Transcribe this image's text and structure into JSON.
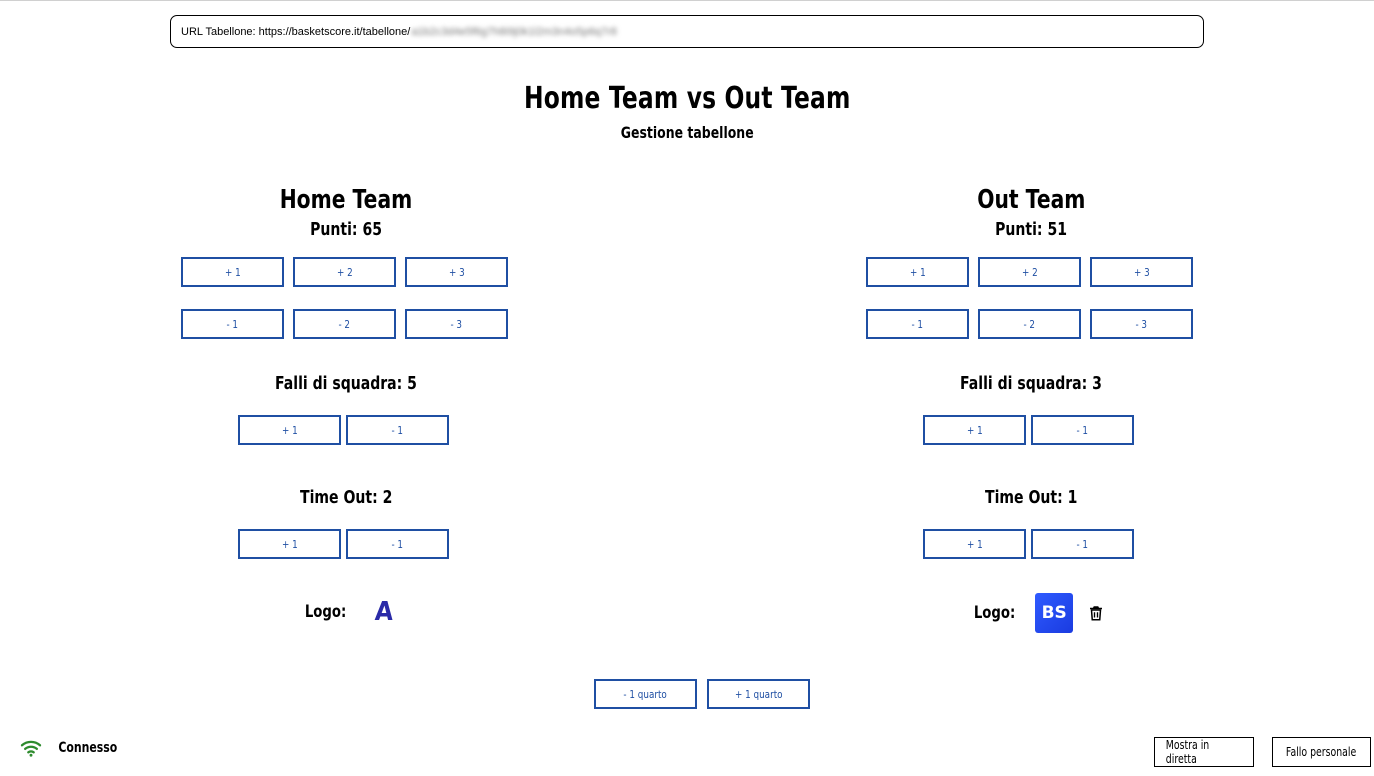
{
  "url_bar": {
    "prefix": "URL Tabellone: https://basketscore.it/tabellone/",
    "hidden": "a1b2c3d4e5f6g7h8i9j0k1l2m3n4o5p6q7r8"
  },
  "header": {
    "title": "Home Team vs Out Team",
    "subtitle": "Gestione tabellone"
  },
  "teams": {
    "home": {
      "name": "Home Team",
      "points_label": "Punti: 65",
      "add_buttons": [
        "+ 1",
        "+ 2",
        "+ 3"
      ],
      "sub_buttons": [
        "- 1",
        "- 2",
        "- 3"
      ],
      "fouls_label": "Falli di squadra: 5",
      "fouls_buttons": [
        "+ 1",
        "- 1"
      ],
      "timeout_label": "Time Out: 2",
      "timeout_buttons": [
        "+ 1",
        "- 1"
      ],
      "logo_label": "Logo:",
      "logo_text": "A"
    },
    "out": {
      "name": "Out Team",
      "points_label": "Punti: 51",
      "add_buttons": [
        "+ 1",
        "+ 2",
        "+ 3"
      ],
      "sub_buttons": [
        "- 1",
        "- 2",
        "- 3"
      ],
      "fouls_label": "Falli di squadra: 3",
      "fouls_buttons": [
        "+ 1",
        "- 1"
      ],
      "timeout_label": "Time Out: 1",
      "timeout_buttons": [
        "+ 1",
        "- 1"
      ],
      "logo_label": "Logo:",
      "logo_text": "BS"
    }
  },
  "quarter": {
    "minus_label": "- 1 quarto",
    "plus_label": "+ 1 quarto"
  },
  "status": {
    "label": "Connesso",
    "color": "#2e8b2e"
  },
  "actions": {
    "live_label": "Mostra in diretta",
    "foul_label": "Fallo personale"
  },
  "colors": {
    "accent": "#1f4fa3",
    "logo_a": "#2a2aa8",
    "logo_bs_bg": "#2f5bff"
  }
}
